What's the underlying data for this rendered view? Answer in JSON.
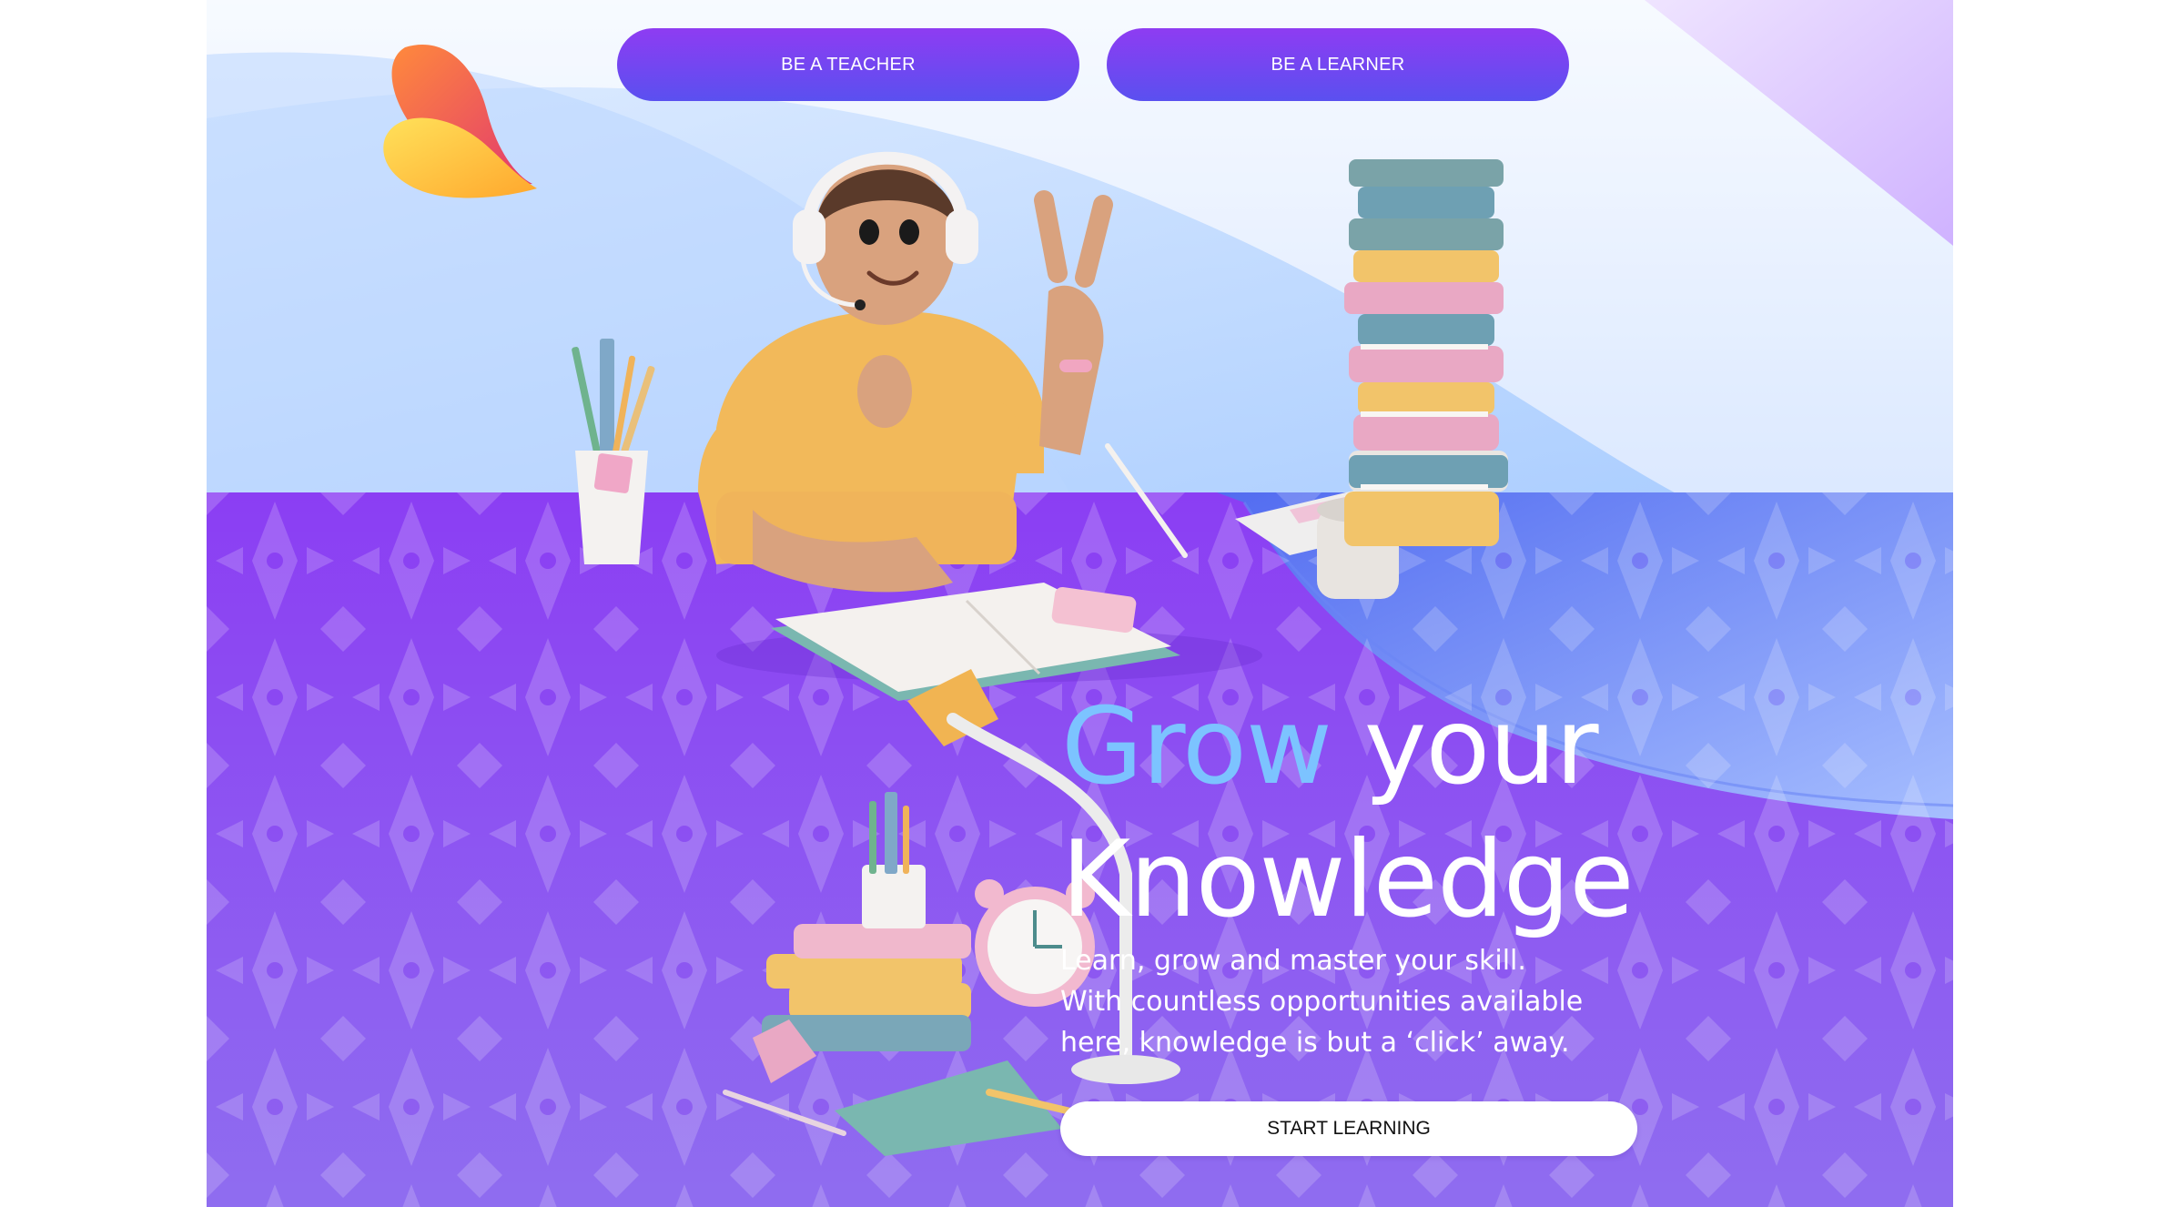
{
  "nav": {
    "teacher_label": "BE A TEACHER",
    "learner_label": "BE A LEARNER"
  },
  "hero": {
    "title_accent": "Grow",
    "title_rest": "your",
    "title_line2": "Knowledge",
    "subtitle_lines": [
      "Learn, grow and master your skill.",
      "With countless opportunities available",
      "here, knowledge is but a ‘click’ away."
    ],
    "cta_label": "START LEARNING"
  },
  "colors": {
    "purple": "#8a3ff2",
    "accent_blue": "#7cc3ff",
    "button_gradient_top": "#8e3cf2",
    "button_gradient_bottom": "#5a50f0"
  },
  "icons": {
    "logo": "flame-logo-icon"
  }
}
